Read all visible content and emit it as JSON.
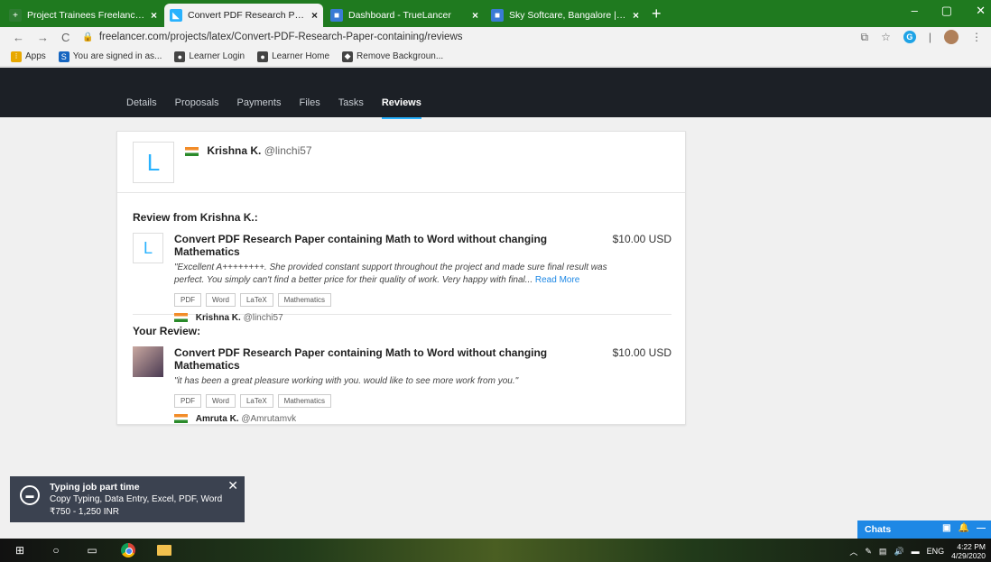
{
  "browser": {
    "tabs": [
      {
        "title": "Project Trainees Freelancing Deta",
        "active": false,
        "fav_color": "#2e7d32",
        "fav_glyph": "+"
      },
      {
        "title": "Convert PDF Research Paper conta",
        "active": true,
        "fav_color": "#29b2fe",
        "fav_glyph": "◣"
      },
      {
        "title": "Dashboard - TrueLancer",
        "active": false,
        "fav_color": "#3a7bd5",
        "fav_glyph": "■"
      },
      {
        "title": "Sky Softcare, Bangalore | Web De",
        "active": false,
        "fav_color": "#3a7bd5",
        "fav_glyph": "■"
      }
    ],
    "tab_close": "×",
    "new_tab": "+",
    "url": "freelancer.com/projects/latex/Convert-PDF-Research-Paper-containing/reviews",
    "bookmarks": [
      {
        "label": "Apps",
        "color": "#e8a800",
        "glyph": "∷"
      },
      {
        "label": "You are signed in as...",
        "color": "#1565c0",
        "glyph": "S"
      },
      {
        "label": "Learner Login",
        "color": "#444",
        "glyph": "●"
      },
      {
        "label": "Learner Home",
        "color": "#444",
        "glyph": "●"
      },
      {
        "label": "Remove Backgroun...",
        "color": "#444",
        "glyph": "◆"
      }
    ]
  },
  "nav": {
    "tabs": [
      "Details",
      "Proposals",
      "Payments",
      "Files",
      "Tasks",
      "Reviews"
    ],
    "active": "Reviews"
  },
  "card": {
    "avatar_letter": "L",
    "name": "Krishna K.",
    "handle": "@linchi57",
    "sections": [
      {
        "title": "Review from Krishna K.:",
        "project": "Convert PDF Research Paper containing Math to Word without changing Mathematics",
        "price": "$10.00 USD",
        "text": "\"Excellent A++++++++. She provided constant support throughout the project and made sure final result was perfect. You simply can't find a better price for their quality of work. Very happy with final...",
        "read_more": "Read More",
        "tags": [
          "PDF",
          "Word",
          "LaTeX",
          "Mathematics"
        ],
        "author_name": "Krishna K.",
        "author_handle": "@linchi57",
        "avatar_letter": "L"
      },
      {
        "title": "Your Review:",
        "project": "Convert PDF Research Paper containing Math to Word without changing Mathematics",
        "price": "$10.00 USD",
        "text": "\"it has been a great pleasure working with you. would like to see more work from you.\"",
        "tags": [
          "PDF",
          "Word",
          "LaTeX",
          "Mathematics"
        ],
        "author_name": "Amruta K.",
        "author_handle": "@Amrutamvk"
      }
    ]
  },
  "toast": {
    "title": "Typing job part time",
    "line1": "Copy Typing, Data Entry, Excel, PDF, Word",
    "line2": "₹750 - 1,250 INR"
  },
  "chats": {
    "label": "Chats"
  },
  "taskbar": {
    "lang": "ENG",
    "time": "4:22 PM",
    "date": "4/29/2020"
  }
}
